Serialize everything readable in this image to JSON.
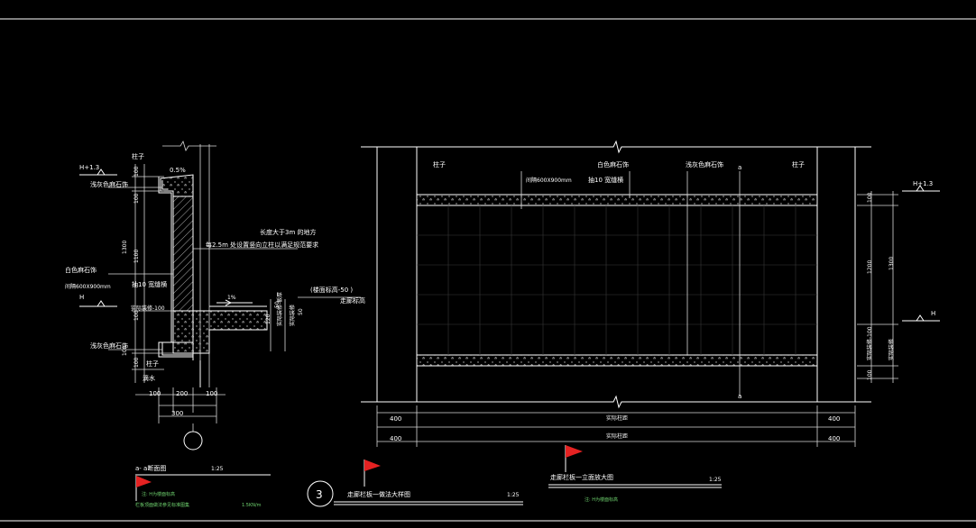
{
  "colors": {
    "background": "#000000",
    "line": "#ffffff",
    "flag": "#e52222",
    "note": "#6fd36f"
  },
  "section": {
    "column_top": "柱子",
    "slope_top": "0.5%",
    "elev_top": "H+1.3",
    "stone_top": "浅灰色麻石饰",
    "stone_white": "白色麻石饰",
    "spacing": "间隔600X900mm",
    "joint": "抽10 宽缝横",
    "elev_h": "H",
    "layer_mid": "实际装修-100",
    "stone_bottom": "浅灰色麻石饰",
    "column_bottom": "柱子",
    "drip": "滴水",
    "note_line1": "长度大于3m 的地方",
    "note_line2": "每2.5m 处设置竖向立柱以满足规范要求",
    "floor_slope": "1%",
    "floor_elev": "(楼面标高-50 )",
    "walkway_label": "走廊标高",
    "slab_label": "实际装修-板厚",
    "slab_label2": "实际装修",
    "dim_100_a": "100",
    "dim_100_b": "100",
    "dim_100_c": "100",
    "dim_1100": "1100",
    "dim_1300": "1300",
    "dim_100_d": "100",
    "dim_100_e": "100",
    "dim_50_a": "50",
    "dim_120": "120",
    "dim_50_b": "50",
    "dim_100_l": "100",
    "dim_200": "200",
    "dim_100_r": "100",
    "dim_300": "300"
  },
  "elevation": {
    "column_left": "柱子",
    "stone_white": "白色麻石饰",
    "stone_grey": "浅灰色麻石饰",
    "marker_a_top": "a",
    "column_right": "柱子",
    "spacing": "间隔600X900mm",
    "joint": "抽10 宽缝横",
    "elev_top": "H+1.3",
    "elev_h": "H",
    "dim_100_top": "100",
    "dim_1200": "1200",
    "dim_1300": "1300",
    "dim_100_mid": "实际装修-100",
    "dim_100_bottom": "100",
    "right_label": "实际装修",
    "marker_a_bottom": "a",
    "dim_400_l1": "400",
    "dim_actual_1": "实际柱距",
    "dim_400_r1": "400",
    "dim_400_l2": "400",
    "dim_actual_2": "实际柱距",
    "dim_400_r2": "400"
  },
  "titles": {
    "section_title": "a- a断面图",
    "section_scale": "1:25",
    "section_note1": "注:  H为楼面标高",
    "section_note2": "栏板顶面做法参见标准图集",
    "section_load": "1.5KN/m",
    "detail_number": "3",
    "detail_title": "走廊栏板一做法大样图",
    "detail_scale": "1:25",
    "elev_title": "走廊栏板一立面放大图",
    "elev_scale": "1:25",
    "elev_note": "注:    H为楼面标高"
  }
}
